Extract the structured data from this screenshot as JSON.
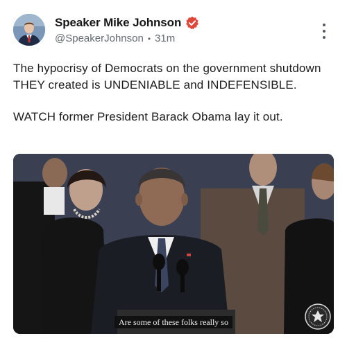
{
  "post": {
    "author": {
      "display_name": "Speaker Mike Johnson",
      "handle": "@SpeakerJohnson",
      "separator": "•",
      "time_ago": "31m",
      "verified_icon": "verified-badge-icon",
      "verified_color": "#e0463a"
    },
    "more_icon": "more-vertical-icon",
    "body": {
      "paragraph_1": "The hypocrisy of Democrats on the government shutdown THEY created is UNDENIABLE and INDEFENSIBLE.",
      "paragraph_2": "WATCH former President Barack Obama lay it out."
    },
    "media": {
      "type": "video",
      "caption": "Are some of these folks really so",
      "seal_icon": "presidential-seal-icon"
    }
  }
}
